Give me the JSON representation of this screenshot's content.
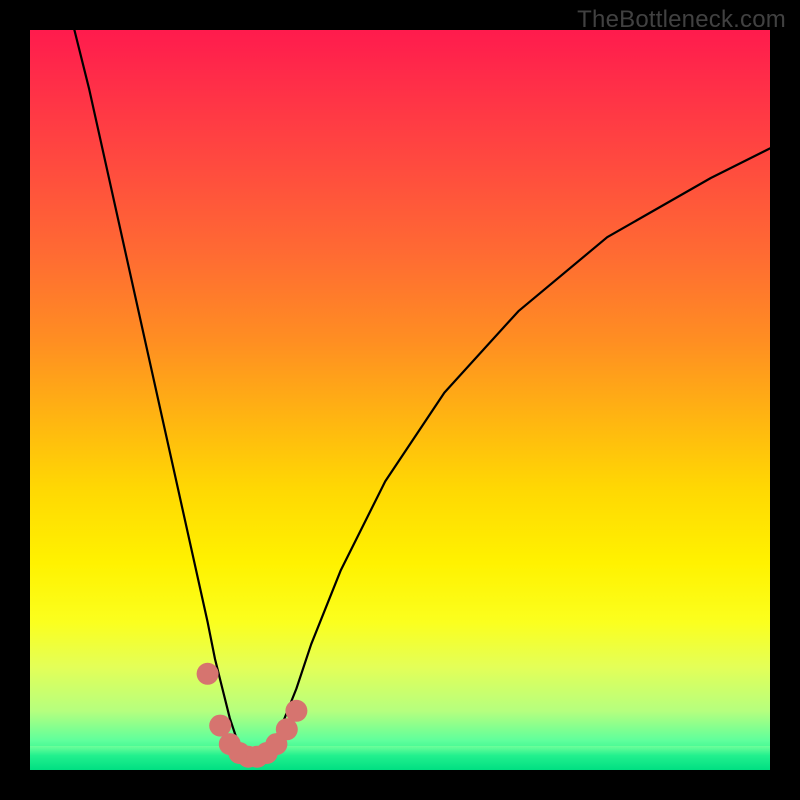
{
  "watermark": "TheBottleneck.com",
  "chart_data": {
    "type": "line",
    "title": "",
    "xlabel": "",
    "ylabel": "",
    "xlim": [
      0,
      100
    ],
    "ylim": [
      0,
      100
    ],
    "grid": false,
    "series": [
      {
        "name": "bottleneck-curve",
        "x": [
          6,
          8,
          10,
          12,
          14,
          16,
          18,
          20,
          22,
          24,
          25,
          26,
          27,
          28,
          29,
          30,
          31,
          32,
          33,
          34,
          36,
          38,
          42,
          48,
          56,
          66,
          78,
          92,
          100
        ],
        "y": [
          100,
          92,
          83,
          74,
          65,
          56,
          47,
          38,
          29,
          20,
          15,
          11,
          7,
          4,
          2,
          1,
          1,
          2,
          4,
          6,
          11,
          17,
          27,
          39,
          51,
          62,
          72,
          80,
          84
        ]
      }
    ],
    "markers": {
      "name": "highlight-dots",
      "color": "#d6746f",
      "points": [
        {
          "x": 24.0,
          "y": 13.0
        },
        {
          "x": 25.7,
          "y": 6.0
        },
        {
          "x": 27.0,
          "y": 3.5
        },
        {
          "x": 28.3,
          "y": 2.3
        },
        {
          "x": 29.5,
          "y": 1.8
        },
        {
          "x": 30.7,
          "y": 1.8
        },
        {
          "x": 32.0,
          "y": 2.3
        },
        {
          "x": 33.3,
          "y": 3.5
        },
        {
          "x": 34.7,
          "y": 5.5
        },
        {
          "x": 36.0,
          "y": 8.0
        }
      ]
    },
    "background_gradient": {
      "top": "#ff1b4d",
      "mid": "#fff200",
      "bottom": "#00e77c"
    }
  }
}
